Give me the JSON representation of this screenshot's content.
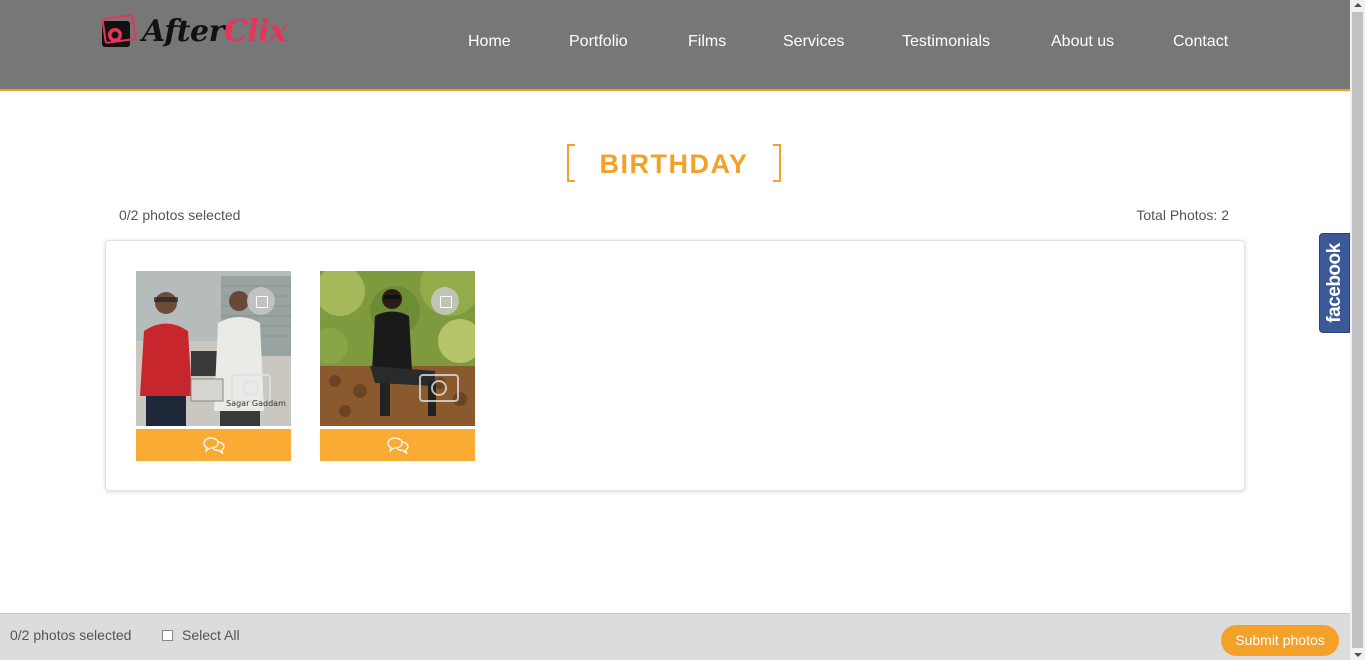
{
  "header": {
    "logo_text_1": "After",
    "logo_text_2": "Clix",
    "nav": [
      "Home",
      "Portfolio",
      "Films",
      "Services",
      "Testimonials",
      "About us",
      "Contact"
    ]
  },
  "album": {
    "title": "BIRTHDAY",
    "selected_text": "0/2 photos selected",
    "total_text": "Total Photos: 2"
  },
  "photos": [
    {
      "watermark": "Sagar Gaddam"
    },
    {
      "watermark": ""
    }
  ],
  "facebook": {
    "label": "facebook"
  },
  "footer": {
    "selected_text": "0/2 photos selected",
    "select_all_label": "Select All",
    "submit_label": "Submit photos"
  },
  "colors": {
    "accent": "#f4a12a",
    "header_bg": "#777777",
    "facebook": "#3b5998",
    "logo_pink": "#e8345a"
  }
}
